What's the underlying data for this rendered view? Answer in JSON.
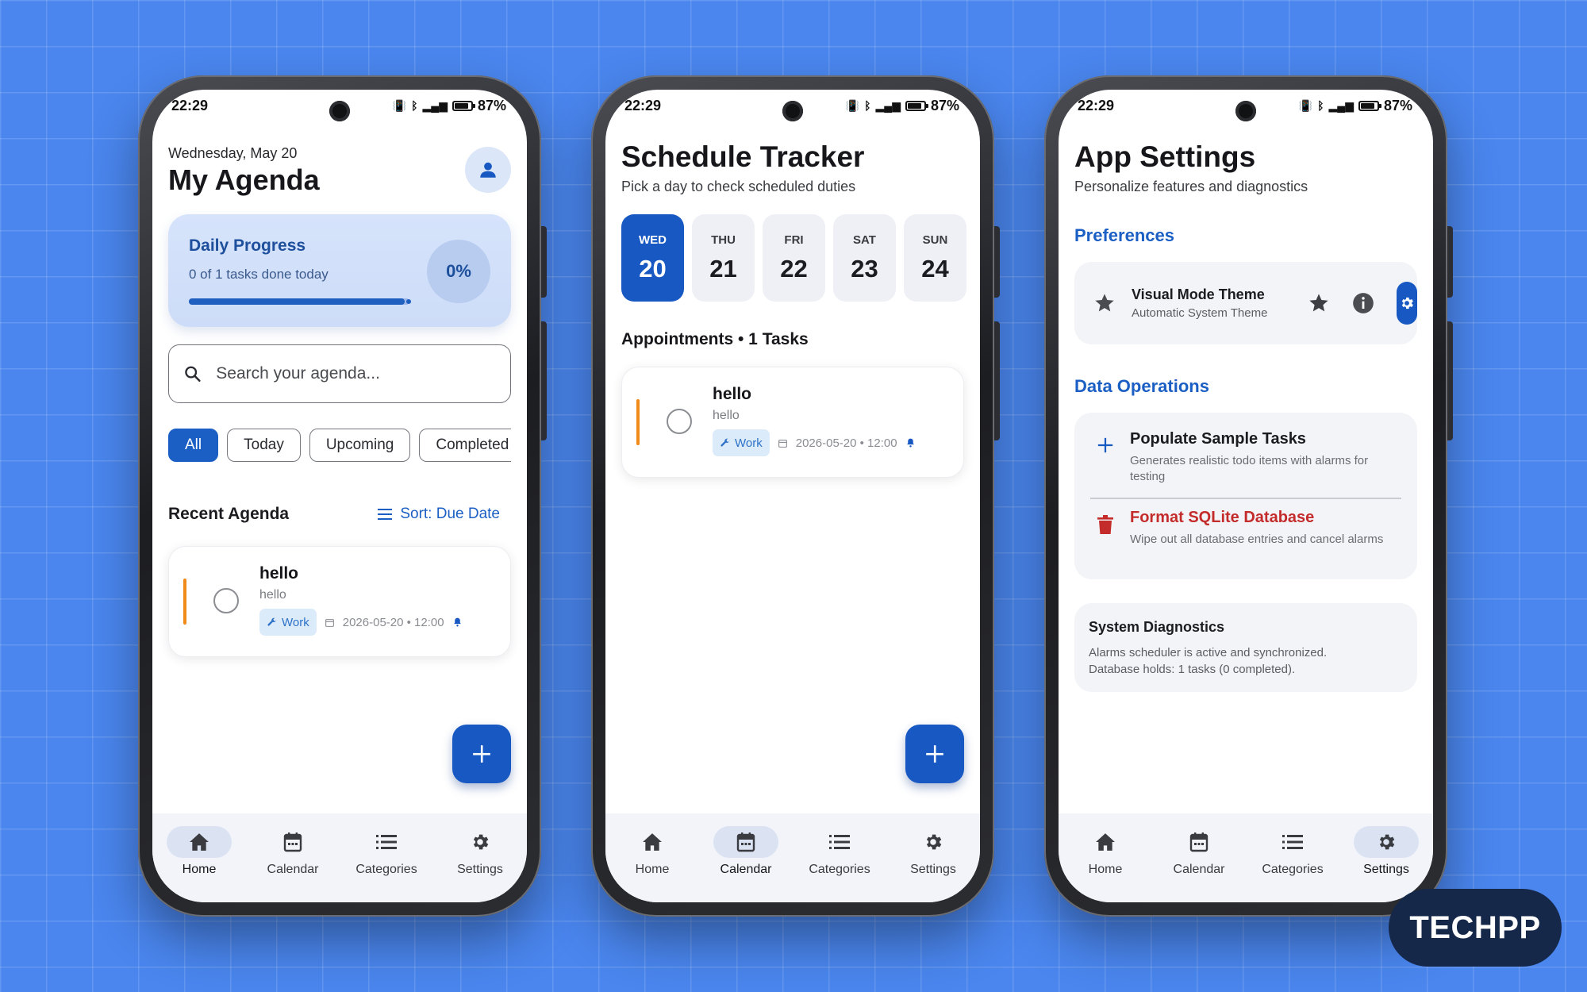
{
  "status_bar": {
    "time": "22:29",
    "battery": "87%",
    "battery_level": 0.87
  },
  "agenda": {
    "date": "Wednesday, May 20",
    "title": "My Agenda",
    "progress": {
      "title": "Daily Progress",
      "subtitle": "0 of 1 tasks done today",
      "percent_label": "0%",
      "bar_level": 0.98
    },
    "search": {
      "placeholder": "Search your agenda...",
      "value": ""
    },
    "filters": [
      "All",
      "Today",
      "Upcoming",
      "Completed"
    ],
    "section_title": "Recent Agenda",
    "sort_label": "Sort: Due Date",
    "task": {
      "title": "hello",
      "description": "hello",
      "tag": "Work",
      "due": "2026-05-20 • 12:00"
    }
  },
  "schedule": {
    "title": "Schedule Tracker",
    "subtitle": "Pick a day to check scheduled duties",
    "days": [
      {
        "dow": "WED",
        "num": "20"
      },
      {
        "dow": "THU",
        "num": "21"
      },
      {
        "dow": "FRI",
        "num": "22"
      },
      {
        "dow": "SAT",
        "num": "23"
      },
      {
        "dow": "SUN",
        "num": "24"
      }
    ],
    "appointments_title": "Appointments • 1 Tasks",
    "task": {
      "title": "hello",
      "description": "hello",
      "tag": "Work",
      "due": "2026-05-20 • 12:00"
    }
  },
  "settings": {
    "title": "App Settings",
    "subtitle": "Personalize features and diagnostics",
    "preferences_title": "Preferences",
    "theme": {
      "title": "Visual Mode Theme",
      "subtitle": "Automatic System Theme"
    },
    "data_ops_title": "Data Operations",
    "populate": {
      "title": "Populate Sample Tasks",
      "subtitle": "Generates realistic todo items with alarms for testing"
    },
    "format": {
      "title": "Format SQLite Database",
      "subtitle": "Wipe out all database entries and cancel alarms"
    },
    "diagnostics": {
      "title": "System Diagnostics",
      "line1": "Alarms scheduler is active and synchronized.",
      "line2": "Database holds: 1 tasks (0 completed)."
    }
  },
  "nav": [
    "Home",
    "Calendar",
    "Categories",
    "Settings"
  ],
  "brand": "TECHPP",
  "colors": {
    "primary": "#1758c2",
    "accent_orange": "#f08a18",
    "danger": "#c42b2b",
    "background": "#4a86ee"
  }
}
